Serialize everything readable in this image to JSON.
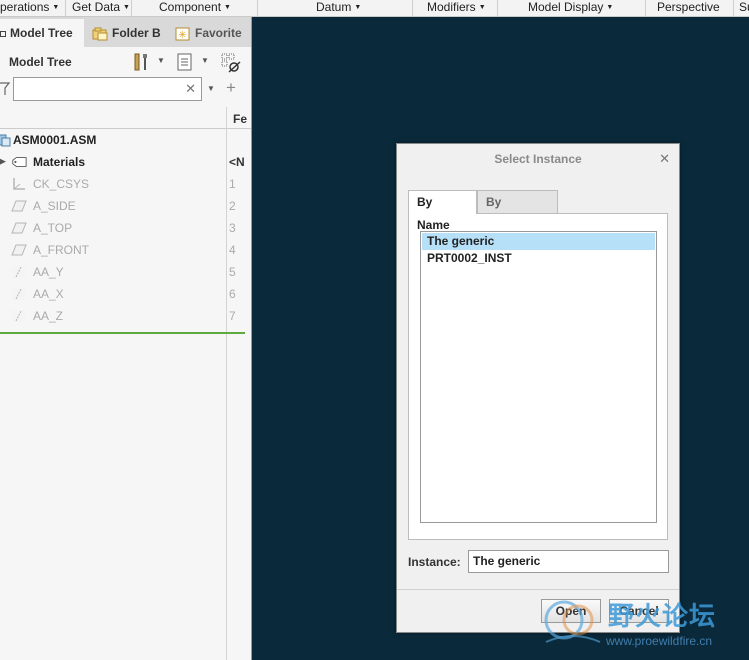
{
  "menubar": {
    "items": [
      {
        "label": "perations"
      },
      {
        "label": "Get Data"
      },
      {
        "label": "Component"
      },
      {
        "label": "Datum"
      },
      {
        "label": "Modifiers"
      },
      {
        "label": "Model Display"
      },
      {
        "label": "Perspective"
      },
      {
        "label": "Su"
      }
    ]
  },
  "left_panel": {
    "tabs": [
      {
        "label": "Model Tree",
        "icon": "model-tree-icon"
      },
      {
        "label": "Folder B",
        "icon": "folder-icon"
      },
      {
        "label": "Favorite",
        "icon": "star-icon"
      }
    ],
    "tree_title": "Model Tree",
    "search_value": "",
    "column_header": "Fe",
    "rows": [
      {
        "label": "ASM0001.ASM",
        "num": "",
        "icon": "assembly-icon",
        "style": "bold"
      },
      {
        "label": "Materials",
        "num": "<N",
        "icon": "material-tag-icon",
        "style": "bold"
      },
      {
        "label": "CK_CSYS",
        "num": "1",
        "icon": "csys-icon",
        "style": "dim"
      },
      {
        "label": "A_SIDE",
        "num": "2",
        "icon": "datum-plane-icon",
        "style": "dim"
      },
      {
        "label": "A_TOP",
        "num": "3",
        "icon": "datum-plane-icon",
        "style": "dim"
      },
      {
        "label": "A_FRONT",
        "num": "4",
        "icon": "datum-plane-icon",
        "style": "dim"
      },
      {
        "label": "AA_Y",
        "num": "5",
        "icon": "datum-axis-icon",
        "style": "dim"
      },
      {
        "label": "AA_X",
        "num": "6",
        "icon": "datum-axis-icon",
        "style": "dim"
      },
      {
        "label": "AA_Z",
        "num": "7",
        "icon": "datum-axis-icon",
        "style": "dim"
      }
    ]
  },
  "dialog": {
    "title": "Select Instance",
    "tabs": [
      "By Name",
      "By Column"
    ],
    "list_items": [
      "The generic",
      "PRT0002_INST"
    ],
    "selected_index": 0,
    "instance_label": "Instance:",
    "instance_value": "The generic",
    "open_label": "Open",
    "cancel_label": "Cancel"
  },
  "watermark": {
    "text": "野火论坛",
    "url": "www.proewildfire.cn"
  },
  "colors": {
    "graphics_background": "#0a2a3b",
    "selection": "#b6e0f7",
    "tree_accent": "#5eaa3e"
  }
}
